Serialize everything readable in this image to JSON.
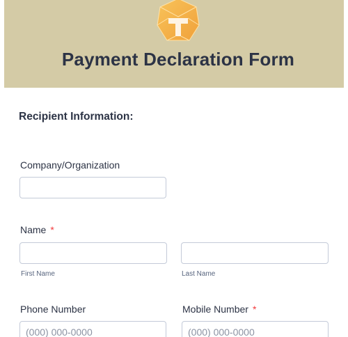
{
  "header": {
    "logo_icon": "shield-emblem-icon",
    "title": "Payment Declaration Form",
    "background": "#d4cba6"
  },
  "section": {
    "title": "Recipient Information:"
  },
  "fields": {
    "company": {
      "label": "Company/Organization",
      "value": ""
    },
    "name": {
      "label": "Name",
      "required_mark": "*",
      "first_sublabel": "First Name",
      "last_sublabel": "Last Name"
    },
    "phone": {
      "label": "Phone Number",
      "placeholder": "(000) 000-0000"
    },
    "mobile": {
      "label": "Mobile Number",
      "required_mark": "*",
      "placeholder": "(000) 000-0000"
    }
  }
}
